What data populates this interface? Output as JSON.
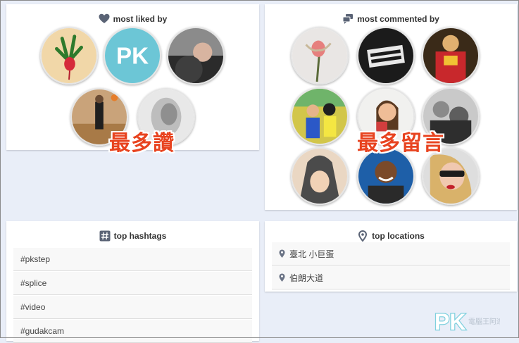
{
  "liked": {
    "title": "most liked by",
    "overlay": "最多讚"
  },
  "commented": {
    "title": "most commented by",
    "overlay": "最多留言"
  },
  "hashtags": {
    "title": "top hashtags",
    "items": [
      "#pkstep",
      "#splice",
      "#video",
      "#gudakcam"
    ]
  },
  "locations": {
    "title": "top locations",
    "items": [
      "臺北 小巨蛋",
      "伯朗大道"
    ]
  },
  "avatar_logo": {
    "text": "PK"
  },
  "watermark": {
    "logo": "PK",
    "sub": "電腦王阿達"
  },
  "colors": {
    "background": "#e9eef8",
    "overlay_red": "#e8431f",
    "icon_gray": "#5a6375"
  }
}
